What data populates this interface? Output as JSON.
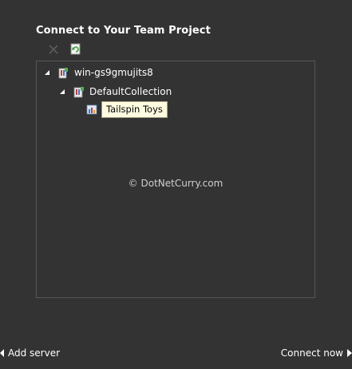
{
  "dialog": {
    "title": "Connect to Your Team Project"
  },
  "toolbar": {
    "delete_icon": "close-x-icon",
    "refresh_icon": "refresh-icon"
  },
  "tree": {
    "server": {
      "label": "win-gs9gmujits8",
      "icon": "server-icon",
      "expanded": true
    },
    "collection": {
      "label": "DefaultCollection",
      "icon": "collection-icon",
      "expanded": true
    },
    "project": {
      "label": "Tailspin Toys",
      "icon": "team-project-icon",
      "selected": true
    }
  },
  "watermark": "© DotNetCurry.com",
  "footer": {
    "add_server_label": "Add server",
    "connect_now_label": "Connect now"
  },
  "colors": {
    "background": "#333333",
    "border": "#575757",
    "tooltip_bg": "#fffce1"
  }
}
